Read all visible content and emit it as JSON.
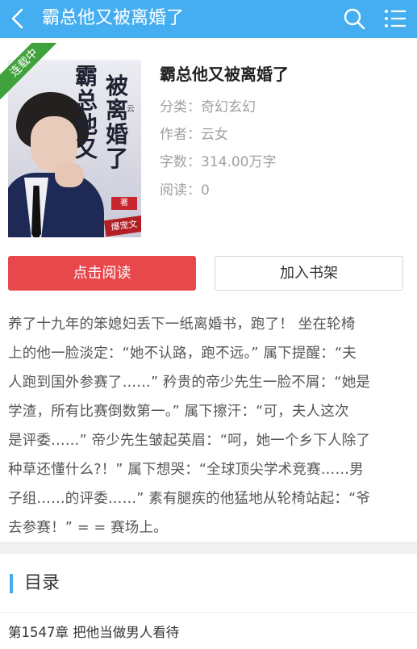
{
  "header": {
    "title": "霸总他又被离婚了",
    "back_icon": "chevron-left-icon",
    "search_icon": "search-icon",
    "menu_icon": "list-menu-icon",
    "bar_color": "#45aef0"
  },
  "book": {
    "status_ribbon": "连载中",
    "cover_title_lines": [
      "霸",
      "总",
      "他",
      "又",
      "被",
      "离",
      "婚",
      "了"
    ],
    "cover_author_tag": "著",
    "cover_corner_text": "云",
    "cover_bottom_tag": "爆宠文",
    "title": "霸总他又被离婚了",
    "category": "分类：奇幻玄幻",
    "author": "作者：云女",
    "word_count": "字数：314.00万字",
    "reads": "阅读：0"
  },
  "actions": {
    "read_label": "点击阅读",
    "shelf_label": "加入书架",
    "read_color": "#e8484c"
  },
  "intro": {
    "lines": [
      "养了十九年的笨媳妇丢下一纸离婚书，跑了！ 坐在轮椅",
      "上的他一脸淡定：“她不认路，跑不远。” 属下提醒：“夫",
      "人跑到国外参赛了……” 矜贵的帝少先生一脸不屑：“她是",
      "学渣，所有比赛倒数第一。” 属下擦汗：“可，夫人这次",
      "是评委……” 帝少先生皱起英眉：“呵，她一个乡下人除了",
      "种草还懂什么?！” 属下想哭：“全球顶尖学术竞赛……男",
      "子组……的评委……” 素有腿疾的他猛地从轮椅站起：“爷",
      "去参赛！” = = 赛场上。"
    ]
  },
  "toc": {
    "title": "目录",
    "chapters": [
      "第1547章 把他当做男人看待"
    ]
  }
}
